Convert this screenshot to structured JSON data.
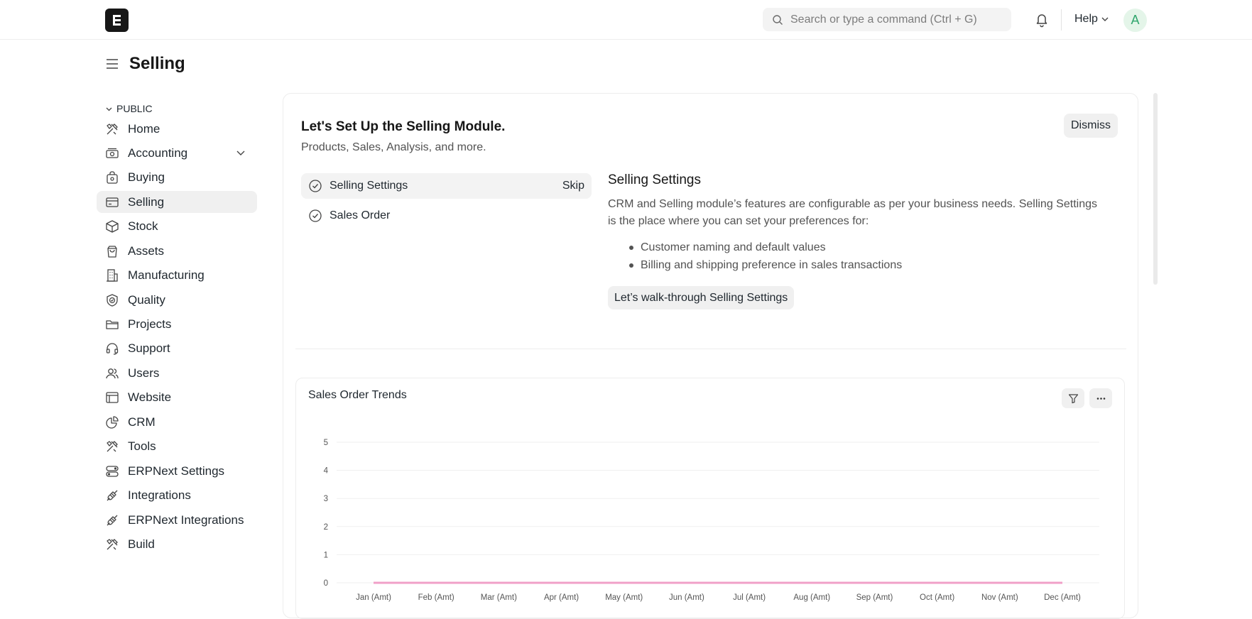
{
  "topbar": {
    "search_placeholder": "Search or type a command (Ctrl + G)",
    "help_label": "Help",
    "avatar_initial": "A"
  },
  "page": {
    "title": "Selling"
  },
  "sidebar": {
    "section_label": "PUBLIC",
    "items": [
      {
        "label": "Home",
        "icon": "tools-icon"
      },
      {
        "label": "Accounting",
        "icon": "money-icon"
      },
      {
        "label": "Buying",
        "icon": "bag-icon"
      },
      {
        "label": "Selling",
        "icon": "card-icon"
      },
      {
        "label": "Stock",
        "icon": "box-icon"
      },
      {
        "label": "Assets",
        "icon": "shopping-bag-icon"
      },
      {
        "label": "Manufacturing",
        "icon": "building-icon"
      },
      {
        "label": "Quality",
        "icon": "shield-check-icon"
      },
      {
        "label": "Projects",
        "icon": "folder-icon"
      },
      {
        "label": "Support",
        "icon": "headset-icon"
      },
      {
        "label": "Users",
        "icon": "users-icon"
      },
      {
        "label": "Website",
        "icon": "browser-icon"
      },
      {
        "label": "CRM",
        "icon": "pie-icon"
      },
      {
        "label": "Tools",
        "icon": "tools-icon"
      },
      {
        "label": "ERPNext Settings",
        "icon": "toggles-icon"
      },
      {
        "label": "Integrations",
        "icon": "plug-icon"
      },
      {
        "label": "ERPNext Integrations",
        "icon": "plug-icon"
      },
      {
        "label": "Build",
        "icon": "tools-icon"
      }
    ]
  },
  "onboarding": {
    "title": "Let's Set Up the Selling Module.",
    "subtitle": "Products, Sales, Analysis, and more.",
    "dismiss_label": "Dismiss",
    "steps": [
      {
        "label": "Selling Settings",
        "action": "Skip"
      },
      {
        "label": "Sales Order"
      }
    ],
    "detail": {
      "title": "Selling Settings",
      "text": "CRM and Selling module’s features are configurable as per your business needs. Selling Settings is the place where you can set your preferences for:",
      "bullets": [
        "Customer naming and default values",
        "Billing and shipping preference in sales transactions"
      ],
      "button_label": "Let’s walk-through Selling Settings"
    }
  },
  "chart": {
    "title": "Sales Order Trends"
  },
  "chart_data": {
    "type": "line",
    "title": "Sales Order Trends",
    "categories": [
      "Jan (Amt)",
      "Feb (Amt)",
      "Mar (Amt)",
      "Apr (Amt)",
      "May (Amt)",
      "Jun (Amt)",
      "Jul (Amt)",
      "Aug (Amt)",
      "Sep (Amt)",
      "Oct (Amt)",
      "Nov (Amt)",
      "Dec (Amt)"
    ],
    "series": [
      {
        "values": [
          0,
          0,
          0,
          0,
          0,
          0,
          0,
          0,
          0,
          0,
          0,
          0
        ],
        "color": "#f0a0c8"
      }
    ],
    "yticks": [
      0,
      1,
      2,
      3,
      4,
      5
    ],
    "ylim": [
      0,
      5
    ],
    "grid": true
  }
}
